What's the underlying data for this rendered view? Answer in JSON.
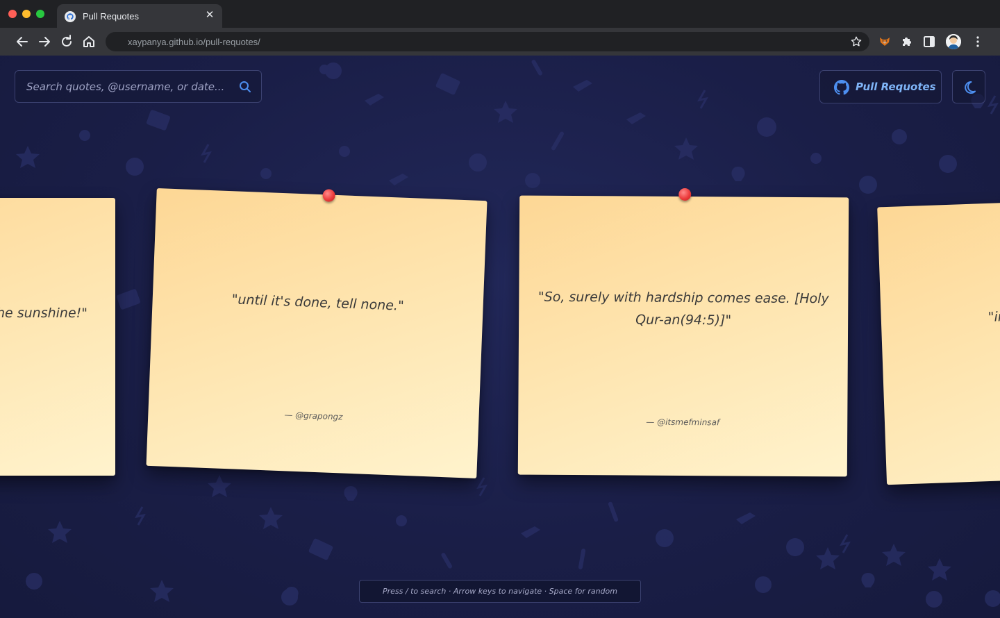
{
  "browser": {
    "tab_title": "Pull Requotes",
    "tab_close": "✕",
    "url": "xaypanya.github.io/pull-requotes/",
    "icons": [
      "back-arrow-icon",
      "forward-arrow-icon",
      "reload-icon",
      "home-icon",
      "bookmark-star-icon",
      "fox-extension-icon",
      "puzzle-extensions-icon",
      "side-panel-icon",
      "profile-avatar",
      "kebab-menu-icon"
    ]
  },
  "header": {
    "search_placeholder": "Search quotes, @username, or date...",
    "github_button_label": "Pull Requotes",
    "theme_toggle": "moon-icon"
  },
  "notes": [
    {
      "quote": "\"Keep shining like the sunshine!\"",
      "author": ""
    },
    {
      "quote": "\"until it's done, tell none.\"",
      "author": "— @grapongz"
    },
    {
      "quote": "\"So, surely with hardship comes ease. [Holy Qur-an(94:5)]\"",
      "author": "— @itsmefminsaf"
    },
    {
      "quote": "\"in",
      "author": ""
    }
  ],
  "hint": "Press / to search · Arrow keys to navigate · Space for random",
  "colors": {
    "background": "#1b1f48",
    "note": "#fee4ae",
    "pin": "#ec3b3b",
    "accent": "#7fb4f7"
  }
}
